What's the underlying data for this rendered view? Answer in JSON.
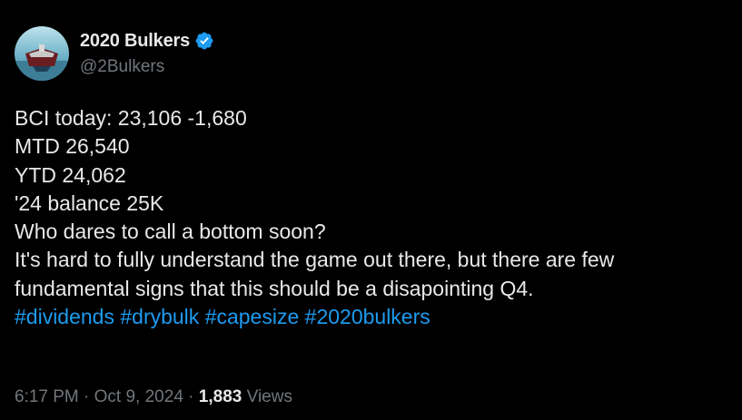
{
  "author": {
    "display_name": "2020 Bulkers",
    "handle": "@2Bulkers",
    "verified_icon": "verified-badge-icon",
    "avatar_icon": "ship-avatar-icon"
  },
  "tweet": {
    "lines": [
      "BCI today: 23,106 -1,680",
      "MTD 26,540",
      "YTD 24,062",
      "'24 balance 25K",
      "Who dares to call a bottom soon?",
      "It's hard to fully understand the game out there, but there are few",
      "fundamental signs that this should be a disapointing Q4."
    ],
    "hashtags": [
      "#dividends",
      "#drybulk",
      "#capesize",
      "#2020bulkers"
    ]
  },
  "meta": {
    "time": "6:17 PM",
    "separator": "·",
    "date": "Oct 9, 2024",
    "views_count": "1,883",
    "views_label": "Views"
  },
  "colors": {
    "background": "#000000",
    "text": "#e7e9ea",
    "secondary": "#71767b",
    "link": "#1d9bf0"
  }
}
